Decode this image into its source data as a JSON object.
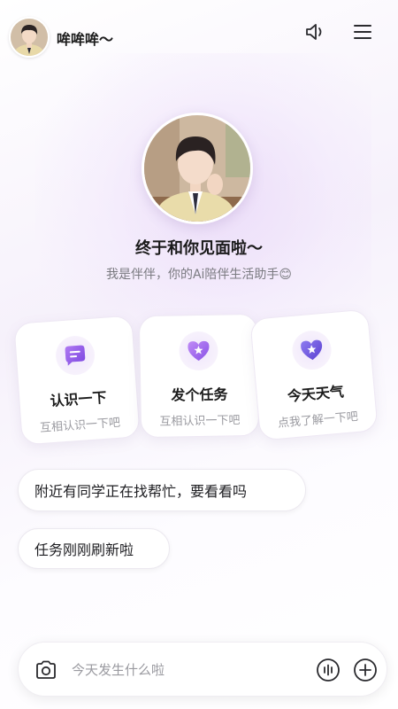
{
  "header": {
    "name": "哞哞哞～",
    "avatar_icon": "boy-avatar-icon",
    "sound_icon": "speaker-icon",
    "menu_icon": "hamburger-menu-icon"
  },
  "hero": {
    "title": "终于和你见面啦～",
    "subtitle": "我是伴伴，你的Ai陪伴生活助手😊"
  },
  "cards": [
    {
      "title": "认识一下",
      "subtitle": "互相认识一下吧",
      "icon": "chat-bubble-icon"
    },
    {
      "title": "发个任务",
      "subtitle": "互相认识一下吧",
      "icon": "heart-star-icon"
    },
    {
      "title": "今天天气",
      "subtitle": "点我了解一下吧",
      "icon": "heart-star-icon"
    }
  ],
  "suggestions": [
    "附近有同学正在找帮忙，要看看吗",
    "任务刚刚刷新啦"
  ],
  "input": {
    "placeholder": "今天发生什么啦",
    "camera_icon": "camera-icon",
    "voice_icon": "voice-wave-icon",
    "add_icon": "plus-circle-icon"
  },
  "colors": {
    "accent": "#9a63ec",
    "accent_dark": "#6c3fd6",
    "text": "#1c1c1c",
    "muted": "#9a9aa0"
  }
}
